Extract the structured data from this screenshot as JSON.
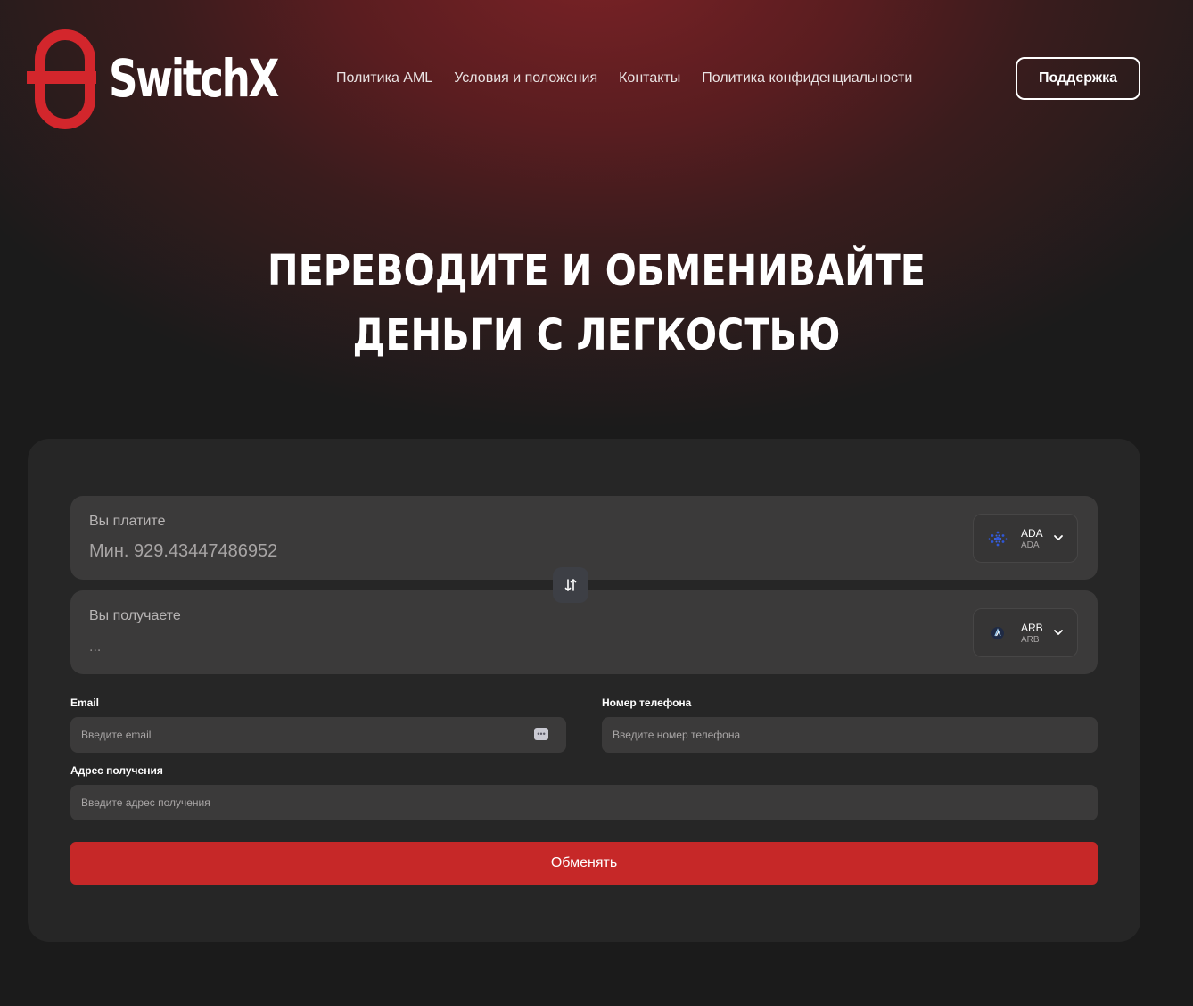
{
  "header": {
    "logo_text": "SwitchX",
    "nav": [
      {
        "label": "Политика AML"
      },
      {
        "label": "Условия и положения"
      },
      {
        "label": "Контакты"
      },
      {
        "label": "Политика конфиденциальности"
      }
    ],
    "support_label": "Поддержка"
  },
  "hero": {
    "line1": "ПЕРЕВОДИТЕ И ОБМЕНИВАЙТЕ",
    "line2": "ДЕНЬГИ С ЛЕГКОСТЬЮ"
  },
  "exchange": {
    "pay": {
      "label": "Вы платите",
      "value": "Мин. 929.43447486952",
      "coin_code": "ADA",
      "coin_sub": "ADA",
      "icon": "cardano-icon"
    },
    "receive": {
      "label": "Вы получаете",
      "value": "...",
      "coin_code": "ARB",
      "coin_sub": "ARB",
      "icon": "arbitrum-icon"
    },
    "swap_icon": "swap-arrows-icon"
  },
  "form": {
    "email_label": "Email",
    "email_placeholder": "Введите email",
    "phone_label": "Номер телефона",
    "phone_placeholder": "Введите номер телефона",
    "address_label": "Адрес получения",
    "address_placeholder": "Введите адрес получения",
    "submit_label": "Обменять"
  },
  "colors": {
    "accent": "#c62828",
    "card": "#262626",
    "field": "#3b3a3a"
  }
}
